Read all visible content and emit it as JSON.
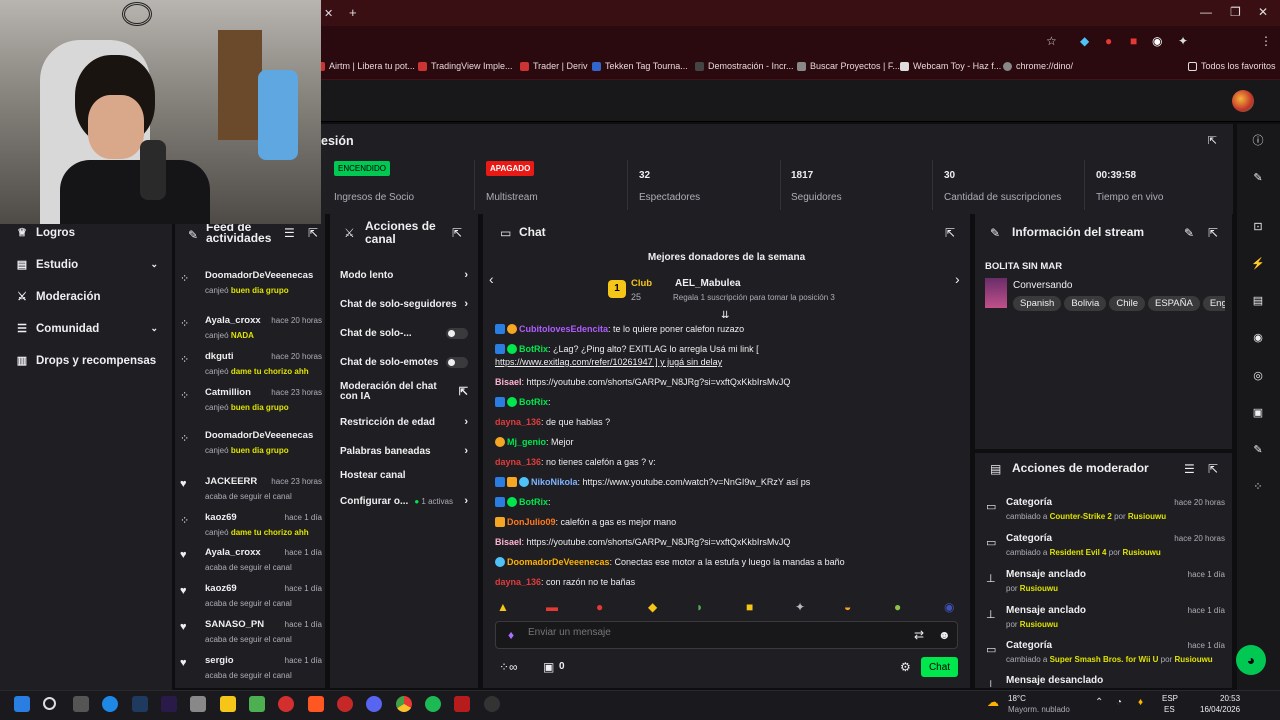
{
  "browser": {
    "bookmarks": [
      "Airtm | Libera tu pot...",
      "TradingView Imple...",
      "Trader | Deriv",
      "Tekken Tag Tourna...",
      "Demostración - Incr...",
      "Buscar Proyectos | F...",
      "Webcam Toy - Haz f...",
      "chrome://dino/",
      "Todos los favoritos"
    ]
  },
  "session": {
    "title": "esión",
    "stats": [
      {
        "value": "ENCENDIDO",
        "label": "Ingresos de Socio"
      },
      {
        "value": "APAGADO",
        "label": "Multistream"
      },
      {
        "value": "32",
        "label": "Espectadores"
      },
      {
        "value": "1817",
        "label": "Seguidores"
      },
      {
        "value": "30",
        "label": "Cantidad de suscripciones"
      },
      {
        "value": "00:39:58",
        "label": "Tiempo en vivo"
      }
    ]
  },
  "nav": {
    "items": [
      "Logros",
      "Estudio",
      "Moderación",
      "Comunidad",
      "Drops y recompensas"
    ]
  },
  "feed": {
    "title": "Feed de actividades",
    "items": [
      {
        "name": "DoomadorDeVeeenecas",
        "time": "",
        "sub": "canjeó",
        "reward": "buen dia grupo"
      },
      {
        "name": "Ayala_croxx",
        "time": "hace 20 horas",
        "sub": "canjeó",
        "reward": "NADA"
      },
      {
        "name": "dkguti",
        "time": "hace 20 horas",
        "sub": "canjeó",
        "reward": "dame tu chorizo ahh"
      },
      {
        "name": "Catmillion",
        "time": "hace 23 horas",
        "sub": "canjeó",
        "reward": "buen dia grupo"
      },
      {
        "name": "DoomadorDeVeeenecas",
        "time": "",
        "sub": "canjeó",
        "reward": "buen dia grupo"
      },
      {
        "name": "JACKEERR",
        "time": "hace 23 horas",
        "sub": "acaba de seguir el canal",
        "reward": ""
      },
      {
        "name": "kaoz69",
        "time": "hace 1 día",
        "sub": "canjeó",
        "reward": "dame tu chorizo ahh"
      },
      {
        "name": "Ayala_croxx",
        "time": "hace 1 día",
        "sub": "acaba de seguir el canal",
        "reward": ""
      },
      {
        "name": "kaoz69",
        "time": "hace 1 día",
        "sub": "acaba de seguir el canal",
        "reward": ""
      },
      {
        "name": "SANASO_PN",
        "time": "hace 1 día",
        "sub": "acaba de seguir el canal",
        "reward": ""
      },
      {
        "name": "sergio",
        "time": "hace 1 día",
        "sub": "acaba de seguir el canal",
        "reward": ""
      }
    ]
  },
  "actions": {
    "title": "Acciones de canal",
    "items": [
      "Modo lento",
      "Chat de solo-seguidores",
      "Chat de solo-...",
      "Chat de solo-emotes",
      "Moderación del chat con IA",
      "Restricción de edad",
      "Palabras baneadas",
      "Hostear canal",
      "Configurar o..."
    ],
    "active_count": "1 activas"
  },
  "chat": {
    "title": "Chat",
    "top_title": "Mejores donadores de la semana",
    "club": "Club",
    "club_count": "25",
    "donor": "AEL_Mabulea",
    "donor_count": "1",
    "donor_sub": "Regala 1 suscripción para tomar la posición 3",
    "messages": [
      {
        "user": "CubitolovesEdencita",
        "color": "#b05cff",
        "text": ": te lo quiere poner calefon ruzazo"
      },
      {
        "user": "BotRix",
        "color": "#00e64d",
        "text": ": ¿Lag? ¿Ping alto? EXITLAG lo arregla   Usá mi link  ["
      },
      {
        "user": "",
        "color": "#efeff1",
        "text": "https://www.exitlag.com/refer/10261947 ] y jugá sin delay"
      },
      {
        "user": "Bisael",
        "color": "#ffb3d1",
        "text": ": https://youtube.com/shorts/GARPw_N8JRg?si=vxftQxKkbIrsMvJQ"
      },
      {
        "user": "BotRix",
        "color": "#00e64d",
        "text": ":"
      },
      {
        "user": "dayna_136",
        "color": "#e03c3c",
        "text": ": de que hablas ?"
      },
      {
        "user": "Mj_genio",
        "color": "#00e64d",
        "text": ": Mejor"
      },
      {
        "user": "dayna_136",
        "color": "#e03c3c",
        "text": ": no tienes calefón a gas ? v:"
      },
      {
        "user": "NikoNikola",
        "color": "#7fb4ff",
        "text": ": https://www.youtube.com/watch?v=NnGI9w_KRzY así ps"
      },
      {
        "user": "BotRix",
        "color": "#00e64d",
        "text": ":"
      },
      {
        "user": "DonJulio09",
        "color": "#ff7a1a",
        "text": ": calefón a gas es mejor mano"
      },
      {
        "user": "Bisael",
        "color": "#ffb3d1",
        "text": ": https://youtube.com/shorts/GARPw_N8JRg?si=vxftQxKkbIrsMvJQ"
      },
      {
        "user": "DoomadorDeVeeenecas",
        "color": "#ffb000",
        "text": ": Conectas ese motor a la estufa y luego la mandas a baño"
      },
      {
        "user": "dayna_136",
        "color": "#e03c3c",
        "text": ": con razón no te bañas"
      }
    ],
    "input_placeholder": "Enviar un mensaje",
    "bits": "0",
    "send_label": "Chat"
  },
  "stream_info": {
    "title": "Información del stream",
    "stream_title": "BOLITA SIN MAR",
    "category": "Conversando",
    "tags": [
      "Spanish",
      "Bolivia",
      "Chile",
      "ESPAÑA",
      "Eng"
    ]
  },
  "mod_actions": {
    "title": "Acciones de moderador",
    "items": [
      {
        "title": "Categoría",
        "time": "hace 20 horas",
        "pre": "cambiado a",
        "hl": "Counter-Strike 2",
        "mid": "por",
        "by": "Rusiouwu"
      },
      {
        "title": "Categoría",
        "time": "hace 20 horas",
        "pre": "cambiado a",
        "hl": "Resident Evil 4",
        "mid": "por",
        "by": "Rusiouwu"
      },
      {
        "title": "Mensaje anclado",
        "time": "hace 1 día",
        "pre": "",
        "hl": "",
        "mid": "por",
        "by": "Rusiouwu"
      },
      {
        "title": "Mensaje anclado",
        "time": "hace 1 día",
        "pre": "",
        "hl": "",
        "mid": "por",
        "by": "Rusiouwu"
      },
      {
        "title": "Categoría",
        "time": "hace 1 día",
        "pre": "cambiado a",
        "hl": "Super Smash Bros. for Wii U",
        "mid": "por",
        "by": "Rusiouwu"
      },
      {
        "title": "Mensaje desanclado",
        "time": "",
        "pre": "",
        "hl": "",
        "mid": "",
        "by": ""
      }
    ]
  },
  "taskbar": {
    "weather_temp": "18°C",
    "weather_desc": "Mayorm. nublado",
    "lang": "ESP",
    "lang2": "ES",
    "time": "20:53",
    "date": "16/04/2026"
  },
  "colors": {
    "accent": "#00e64d",
    "highlight": "#dfe300",
    "twitch_bg": "#0e0e10",
    "panel": "#1f1f23"
  }
}
